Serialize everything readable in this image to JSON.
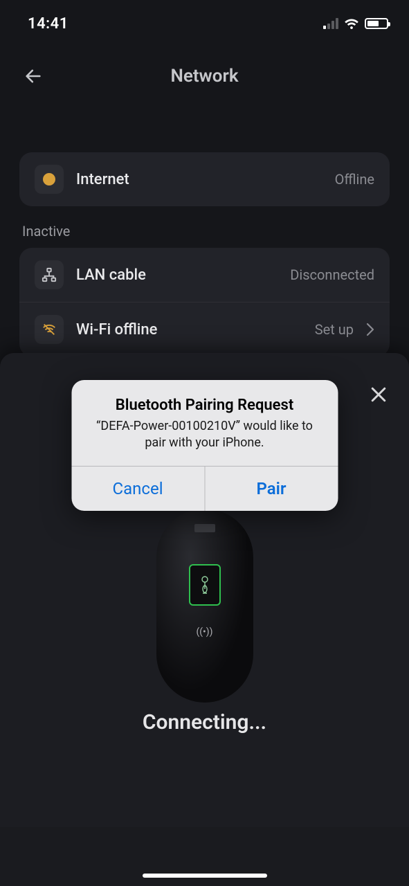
{
  "status": {
    "time": "14:41"
  },
  "header": {
    "title": "Network"
  },
  "internet": {
    "label": "Internet",
    "status": "Offline"
  },
  "inactive_label": "Inactive",
  "lan": {
    "label": "LAN cable",
    "status": "Disconnected"
  },
  "wifi": {
    "label": "Wi-Fi offline",
    "status": "Set up"
  },
  "sheet": {
    "status_text": "Connecting..."
  },
  "alert": {
    "title": "Bluetooth Pairing Request",
    "message": "“DEFA-Power-00100210V” would like to pair with your iPhone.",
    "cancel": "Cancel",
    "pair": "Pair"
  }
}
